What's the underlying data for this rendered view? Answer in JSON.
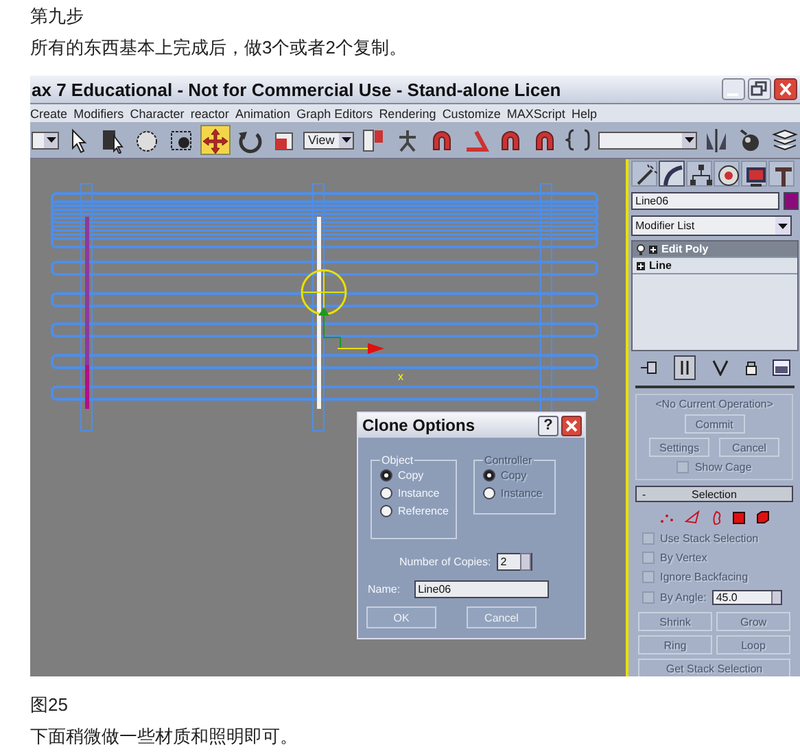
{
  "heading": "第九步",
  "intro": "所有的东西基本上完成后，做3个或者2个复制。",
  "screenshot": {
    "title": "ax 7  Educational - Not for Commercial Use - Stand-alone Licen",
    "menu": [
      "Create",
      "Modifiers",
      "Character",
      "reactor",
      "Animation",
      "Graph Editors",
      "Rendering",
      "Customize",
      "MAXScript",
      "Help"
    ],
    "toolbar": [
      {
        "kind": "dropdown"
      },
      {
        "kind": "pointer",
        "selected": false
      },
      {
        "kind": "list",
        "selected": false
      },
      {
        "kind": "circle",
        "selected": false
      },
      {
        "kind": "dotted",
        "selected": false
      },
      {
        "kind": "move",
        "selected": true
      },
      {
        "kind": "rotate",
        "selected": false
      },
      {
        "kind": "scale",
        "selected": false
      },
      {
        "kind": "dropdown",
        "value": "View"
      },
      {
        "kind": "pivot",
        "selected": false
      },
      {
        "kind": "figure",
        "selected": false
      },
      {
        "kind": "magnet",
        "selected": false
      },
      {
        "kind": "angle",
        "selected": false
      },
      {
        "kind": "magnet",
        "selected": false
      },
      {
        "kind": "magnet",
        "selected": false
      },
      {
        "kind": "bracket",
        "selected": false
      },
      {
        "kind": "wide-dropdown"
      },
      {
        "kind": "mirror",
        "selected": false
      },
      {
        "kind": "sphere",
        "selected": false
      },
      {
        "kind": "layers",
        "selected": false
      }
    ],
    "viewport": {
      "axis_label": "x"
    },
    "clone_dialog": {
      "title": "Clone Options",
      "help": "?",
      "object_group": {
        "label": "Object",
        "options": [
          {
            "label": "Copy",
            "selected": true
          },
          {
            "label": "Instance",
            "selected": false
          },
          {
            "label": "Reference",
            "selected": false
          }
        ]
      },
      "controller_group": {
        "label": "Controller",
        "disabled": true,
        "options": [
          {
            "label": "Copy",
            "selected": true
          },
          {
            "label": "Instance",
            "selected": false
          }
        ]
      },
      "copies_label": "Number of Copies:",
      "copies_value": "2",
      "name_label": "Name:",
      "name_value": "Line06",
      "buttons": [
        "OK",
        "Cancel"
      ]
    },
    "command_panel": {
      "tabs": [
        {
          "kind": "wand",
          "selected": false
        },
        {
          "kind": "curve",
          "selected": true
        },
        {
          "kind": "hierarchy",
          "selected": false
        },
        {
          "kind": "motion",
          "selected": false
        },
        {
          "kind": "display",
          "selected": false
        },
        {
          "kind": "hammer",
          "selected": false
        }
      ],
      "object_name": "Line06",
      "modifier_list": "Modifier List",
      "stack": [
        {
          "label": "Edit Poly",
          "selected": true
        },
        {
          "label": "Line",
          "selected": false
        }
      ],
      "operation": "<No Current Operation>",
      "commit": {
        "label": "Commit",
        "disabled": true
      },
      "settings": {
        "label": "Settings",
        "disabled": true
      },
      "cancel": {
        "label": "Cancel",
        "disabled": true
      },
      "show_cage": {
        "label": "Show Cage",
        "checked": false,
        "disabled": true
      },
      "selection": {
        "toggle": "-",
        "title": "Selection",
        "checkboxes": [
          {
            "label": "Use Stack Selection",
            "checked": false,
            "disabled": true
          },
          {
            "label": "By Vertex",
            "checked": false,
            "disabled": true
          },
          {
            "label": "Ignore Backfacing",
            "checked": false,
            "disabled": true
          },
          {
            "label": "By Angle:",
            "checked": false,
            "disabled": true
          }
        ],
        "angle_value": "45.0",
        "buttons": [
          {
            "label": "Shrink",
            "disabled": true
          },
          {
            "label": "Grow",
            "disabled": true
          },
          {
            "label": "Ring",
            "disabled": true
          },
          {
            "label": "Loop",
            "disabled": true
          },
          {
            "label": "Get Stack Selection",
            "disabled": true
          }
        ]
      }
    }
  },
  "caption": "图25",
  "outro": "下面稍微做一些材质和照明即可。"
}
